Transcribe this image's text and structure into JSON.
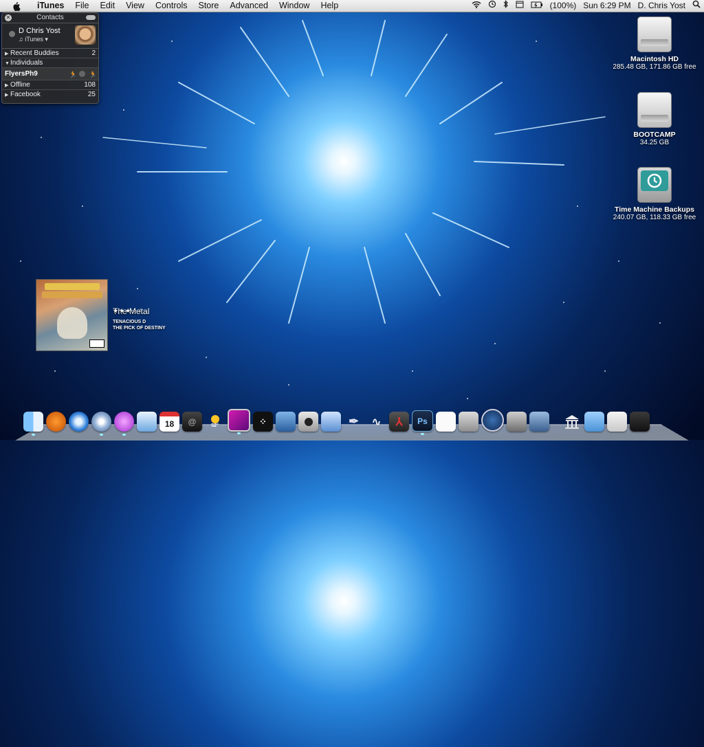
{
  "menubar": {
    "app": "iTunes",
    "menus": [
      "File",
      "Edit",
      "View",
      "Controls",
      "Store",
      "Advanced",
      "Window",
      "Help"
    ],
    "battery": "(100%)",
    "clock": "Sun 6:29 PM",
    "user": "D. Chris Yost"
  },
  "contacts": {
    "title": "Contacts",
    "me_name": "D Chris Yost",
    "me_status": "♫ iTunes ▾",
    "groups": [
      {
        "label": "Recent Buddies",
        "count": "2"
      },
      {
        "label": "Individuals",
        "count": ""
      },
      {
        "label": "Offline",
        "count": "108"
      },
      {
        "label": "Facebook",
        "count": "25"
      }
    ],
    "buddy": "FlyersPh9"
  },
  "desktop_icons": [
    {
      "label": "Macintosh HD",
      "sub": "285.48 GB, 171.86 GB free",
      "icon": "hard-drive-icon"
    },
    {
      "label": "BOOTCAMP",
      "sub": "34.25 GB",
      "icon": "hard-drive-icon"
    },
    {
      "label": "Time Machine Backups",
      "sub": "240.07 GB, 118.33 GB free",
      "icon": "time-machine-icon"
    }
  ],
  "now_playing": {
    "song": "The Metal",
    "rating": "★★★☆☆",
    "artist": "TENACIOUS D",
    "album": "THE PICK OF DESTINY"
  },
  "dock": {
    "calendar_day": "18",
    "temp": "52°",
    "photoshop": "Ps"
  }
}
